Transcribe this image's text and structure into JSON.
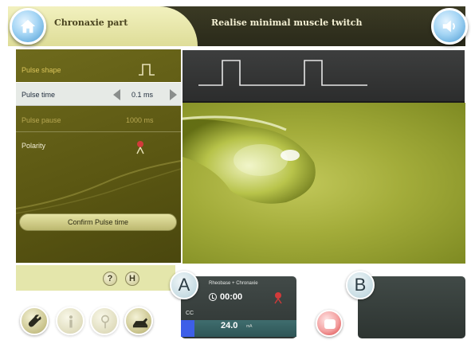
{
  "header": {
    "tab_label": "Chronaxie part",
    "title": "Realise minimal muscle twitch",
    "home_icon": "home-icon",
    "sound_icon": "speaker-icon"
  },
  "settings": {
    "pulse_shape_label": "Pulse shape",
    "pulse_time_label": "Pulse time",
    "pulse_time_value": "0.1 ms",
    "pulse_pause_label": "Pulse pause",
    "pulse_pause_value": "1000 ms",
    "polarity_label": "Polarity",
    "confirm_label": "Confirm Pulse time"
  },
  "toolbar": {
    "help_label": "?",
    "save_label": "H"
  },
  "channel_a": {
    "badge": "A",
    "mode": "Rheobase + Chronaxie",
    "time": "00:00",
    "current_type": "CC",
    "intensity": "24.0",
    "unit": "mA",
    "level_percent": 12
  },
  "channel_b": {
    "badge": "B"
  },
  "colors": {
    "header_bg": "#2e2e1e",
    "tab_active": "#e8e7ae",
    "panel_bg": "#5f5b16",
    "channel_bar": "#3d5fe8",
    "stop_red": "#d83c3c"
  }
}
